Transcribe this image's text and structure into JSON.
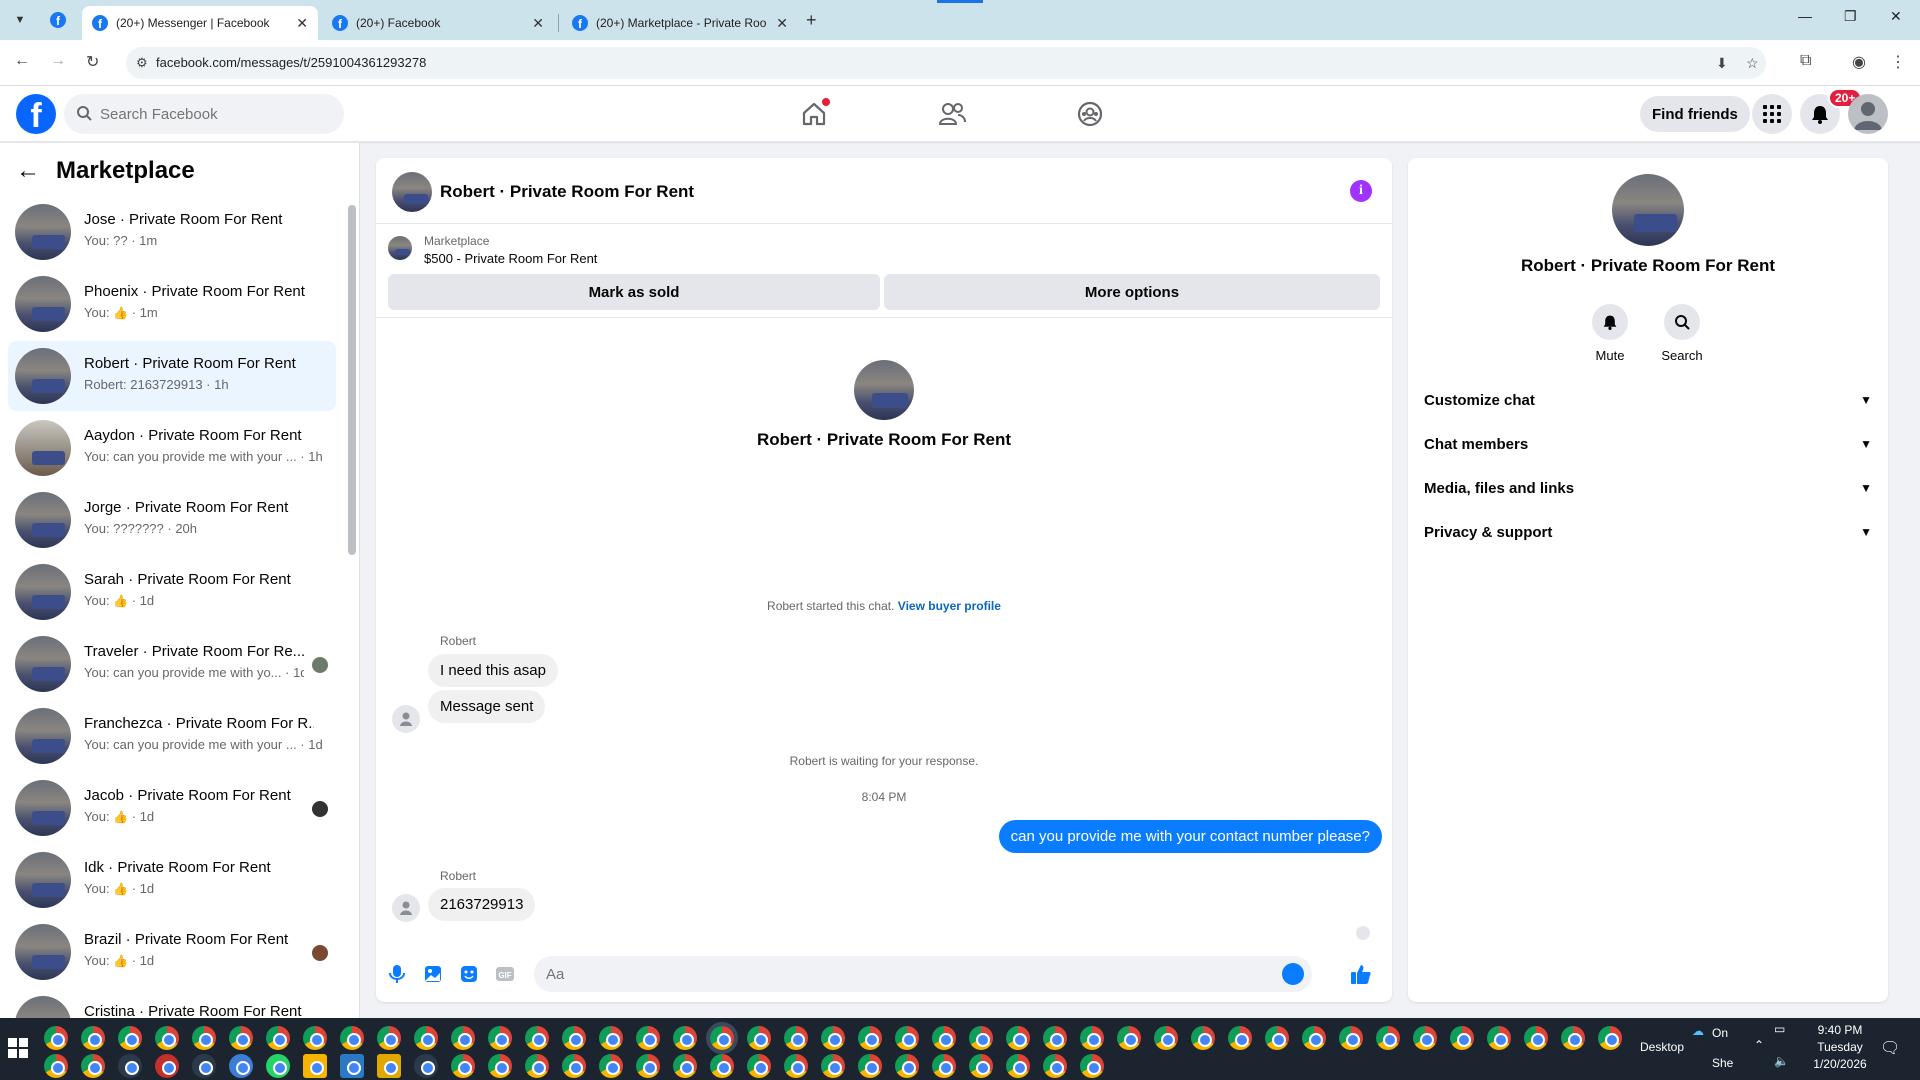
{
  "browser": {
    "tabs": [
      {
        "title": "(20+) Messenger | Facebook",
        "active": true
      },
      {
        "title": "(20+) Facebook",
        "active": false
      },
      {
        "title": "(20+) Marketplace - Private Roo",
        "active": false
      }
    ],
    "url": "facebook.com/messages/t/2591004361293278"
  },
  "fb_nav": {
    "search_placeholder": "Search Facebook",
    "find_friends_label": "Find friends",
    "notification_badge": "20+"
  },
  "left": {
    "title": "Marketplace",
    "conversations": [
      {
        "name": "Jose · Private Room For Rent",
        "preview": "You: ?? · 1m"
      },
      {
        "name": "Phoenix · Private Room For Rent",
        "preview_prefix": "You:",
        "preview_suffix": "· 1m"
      },
      {
        "name": "Robert · Private Room For Rent",
        "preview": "Robert: 2163729913 · 1h",
        "active": true
      },
      {
        "name": "Aaydon · Private Room For Rent",
        "preview": "You: can you provide me with your ... · 1h"
      },
      {
        "name": "Jorge · Private Room For Rent",
        "preview": "You: ??????? · 20h"
      },
      {
        "name": "Sarah · Private Room For Rent",
        "preview_prefix": "You:",
        "preview_suffix": "· 1d"
      },
      {
        "name": "Traveler · Private Room For Re...",
        "preview": "You: can you provide me with yo... · 1d"
      },
      {
        "name": "Franchezca · Private Room For R...",
        "preview": "You: can you provide me with your ... · 1d"
      },
      {
        "name": "Jacob · Private Room For Rent",
        "preview_prefix": "You:",
        "preview_suffix": "· 1d"
      },
      {
        "name": "Idk · Private Room For Rent",
        "preview_prefix": "You:",
        "preview_suffix": "· 1d"
      },
      {
        "name": "Brazil · Private Room For Rent",
        "preview_prefix": "You:",
        "preview_suffix": "· 1d"
      },
      {
        "name": "Cristina · Private Room For Rent",
        "preview": ""
      }
    ]
  },
  "chat": {
    "header_name": "Robert · Private Room For Rent",
    "marketplace_label": "Marketplace",
    "listing": "$500 - Private Room For Rent",
    "mark_sold_label": "Mark as sold",
    "more_options_label": "More options",
    "intro_name": "Robert · Private Room For Rent",
    "started_text": "Robert started this chat.",
    "view_buyer_profile": "View buyer profile",
    "sender1": "Robert",
    "msg1": "I need this asap",
    "msg2": "Message sent",
    "waiting_text": "Robert is waiting for your response.",
    "time": "8:04 PM",
    "my_msg": "can you provide me with your contact number please?",
    "sender2": "Robert",
    "msg3": "2163729913",
    "composer_placeholder": "Aa"
  },
  "details": {
    "name": "Robert · Private Room For Rent",
    "mute_label": "Mute",
    "search_label": "Search",
    "sections": [
      "Customize chat",
      "Chat members",
      "Media, files and links",
      "Privacy & support"
    ]
  },
  "taskbar": {
    "desktop_label": "Desktop",
    "weather_label": "On",
    "weather_label2": "She",
    "time": "9:40 PM",
    "day": "Tuesday",
    "date": "1/20/2026"
  },
  "colors": {
    "fb_blue": "#0866ff",
    "messenger_bubble": "#0a7cff",
    "info_purple": "#a033ff",
    "badge_red": "#e41e3f"
  }
}
